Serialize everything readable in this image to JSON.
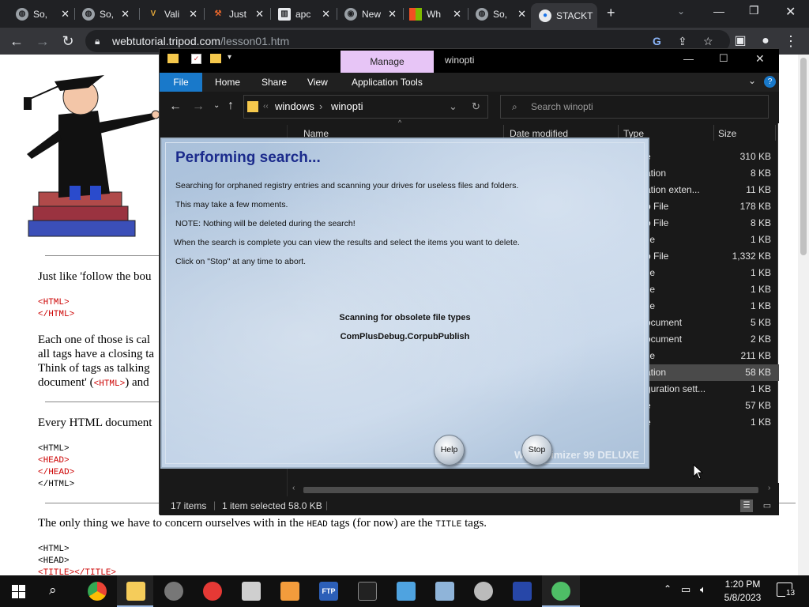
{
  "browser": {
    "tabs": [
      {
        "title": "So,",
        "icon": "globe-icon"
      },
      {
        "title": "So,",
        "icon": "globe-icon"
      },
      {
        "title": "Vali",
        "icon": "v-logo-icon"
      },
      {
        "title": "Just",
        "icon": "anvil-icon"
      },
      {
        "title": "apc",
        "icon": "building-icon"
      },
      {
        "title": "New",
        "icon": "chrome-icon"
      },
      {
        "title": "Wh",
        "icon": "microsoft-icon"
      },
      {
        "title": "So,",
        "icon": "globe-icon"
      },
      {
        "title": "STACKT",
        "icon": "stack-icon"
      }
    ],
    "url_domain": "webtutorial.tripod.com",
    "url_path": "/lesson01.htm"
  },
  "webpage": {
    "para1": "Just like 'follow the bou",
    "code1": [
      "<HTML>",
      "</HTML>"
    ],
    "para2_lines": [
      "Each one of those is cal",
      "all tags have a closing ta",
      "Think of tags as talking",
      "document' ("
    ],
    "para2_code": "<HTML>",
    "para2_tail": ") and",
    "para3": "Every HTML document",
    "code2": [
      "<HTML>",
      "<HEAD>",
      "</HEAD>",
      "</HTML>"
    ],
    "para4_a": "The only thing we have to concern ourselves with in the ",
    "para4_head": "HEAD",
    "para4_b": " tags (for now) are the ",
    "para4_title": "TITLE",
    "para4_c": " tags.",
    "code3": [
      "<HTML>",
      "<HEAD>",
      "<TITLE></TITLE>"
    ]
  },
  "explorer": {
    "manage_tab": "Manage",
    "window_title": "winopti",
    "ribbon": {
      "file": "File",
      "home": "Home",
      "share": "Share",
      "view": "View",
      "app_tools": "Application Tools"
    },
    "path": [
      "windows",
      "winopti"
    ],
    "search_placeholder": "Search winopti",
    "columns": {
      "name": "Name",
      "date": "Date modified",
      "type": "Type",
      "size": "Size"
    },
    "rows": [
      {
        "type": "e",
        "size": "310 KB"
      },
      {
        "type": "ation",
        "size": "8 KB"
      },
      {
        "type": "ation exten...",
        "size": "11 KB"
      },
      {
        "type": "o File",
        "size": "178 KB"
      },
      {
        "type": "o File",
        "size": "8 KB"
      },
      {
        "type": "ile",
        "size": "1 KB"
      },
      {
        "type": "o File",
        "size": "1,332 KB"
      },
      {
        "type": "ile",
        "size": "1 KB"
      },
      {
        "type": "ile",
        "size": "1 KB"
      },
      {
        "type": "ile",
        "size": "1 KB"
      },
      {
        "type": "ocument",
        "size": "5 KB"
      },
      {
        "type": "ocument",
        "size": "2 KB"
      },
      {
        "type": "ile",
        "size": "211 KB"
      },
      {
        "type": "ation",
        "size": "58 KB"
      },
      {
        "type": "guration sett...",
        "size": "1 KB"
      },
      {
        "type": "e",
        "size": "57 KB"
      },
      {
        "type": "e",
        "size": "1 KB"
      }
    ],
    "selected_row": 13,
    "status_items": "17 items",
    "status_selected": "1 item selected  58.0 KB"
  },
  "dialog": {
    "title": "Performing search...",
    "lines": [
      "Searching for orphaned registry entries and scanning your drives for useless files and folders.",
      "This may take a few moments.",
      "NOTE: Nothing will be deleted during the search!",
      "When the search is complete you can view the results and select the items you want to delete.",
      "Click on \"Stop\" at any time to abort."
    ],
    "status_label": "Scanning for obsolete file types",
    "current_item": "ComPlusDebug.CorpubPublish",
    "help_button": "Help",
    "stop_button": "Stop",
    "brand": "WinOptimizer 99 DELUXE"
  },
  "taskbar": {
    "time": "1:20 PM",
    "date": "5/8/2023",
    "notification_count": "13",
    "apps": [
      "chrome-icon",
      "file-explorer-icon",
      "satellite-dish-icon",
      "arrow-app-icon",
      "radio-app-icon",
      "tools-app-icon",
      "ftp-icon",
      "terminal-icon",
      "image-viewer-icon",
      "network-icon",
      "wrench-icon",
      "azure-icon",
      "recycle-icon"
    ]
  },
  "colors": {
    "accent": "#1979ca",
    "manage_tab": "#e7c5f6",
    "dialog_title": "#1b2b8c"
  }
}
